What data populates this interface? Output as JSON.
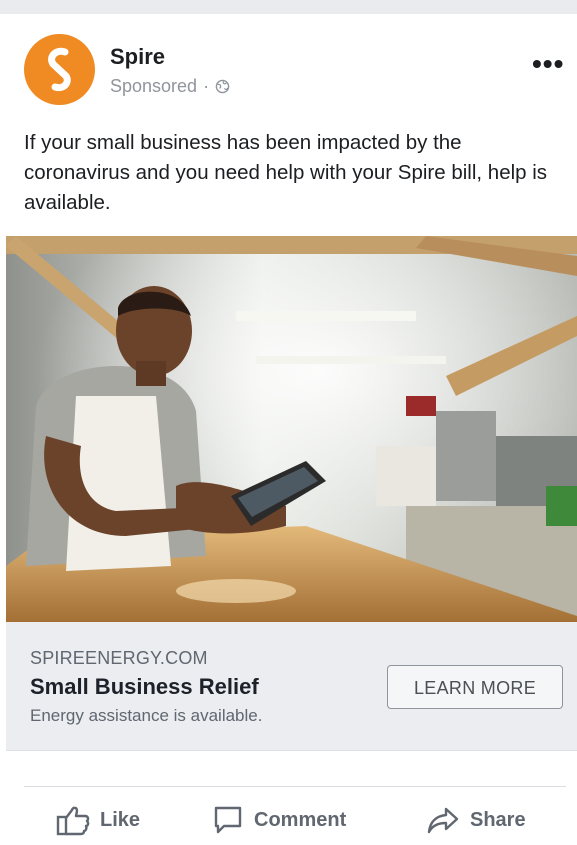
{
  "post": {
    "page_name": "Spire",
    "sponsored_label": "Sponsored",
    "separator": "·",
    "more_label": "•••",
    "text": "If your small business has been impacted by the coronavirus and you need help with your Spire bill, help is available."
  },
  "link": {
    "domain": "SPIREENERGY.COM",
    "headline": "Small Business Relief",
    "description": "Energy assistance is available.",
    "cta": "LEARN MORE"
  },
  "actions": {
    "like": "Like",
    "comment": "Comment",
    "share": "Share"
  },
  "colors": {
    "brand_orange": "#f08a22",
    "link_bg": "#ebedf0",
    "action_gray": "#606770"
  }
}
